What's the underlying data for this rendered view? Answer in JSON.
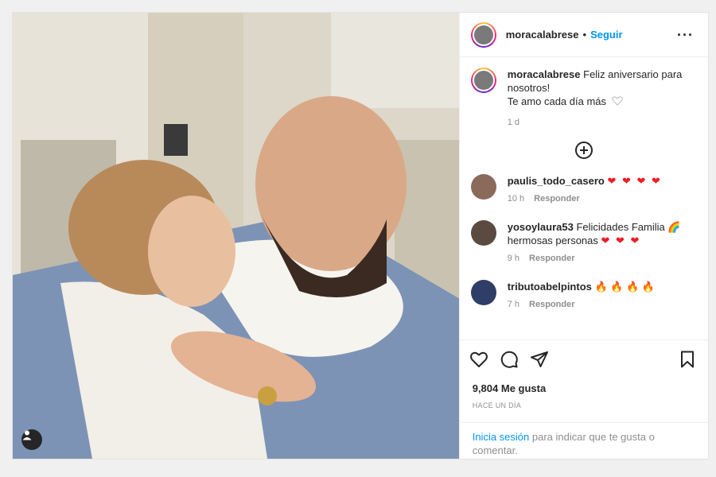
{
  "post": {
    "username": "moracalabrese",
    "follow_label": "Seguir",
    "separator": "•",
    "more_label": "···",
    "caption_line1": "Feliz aniversario para nosotros!",
    "caption_line2": "Te amo cada día más",
    "caption_time": "1 d",
    "likes": "9,804 Me gusta",
    "posted_ago": "HACE UN DÍA"
  },
  "comments": [
    {
      "user": "paulis_todo_casero",
      "text": "",
      "emoji": "❤ ❤ ❤ ❤",
      "time": "10 h",
      "reply": "Responder"
    },
    {
      "user": "yosoylaura53",
      "text": "Felicidades Familia 🌈 hermosas personas",
      "emoji": "❤ ❤ ❤",
      "time": "9 h",
      "reply": "Responder"
    },
    {
      "user": "tributoabelpintos",
      "text": "",
      "emoji": "🔥 🔥 🔥 🔥",
      "time": "7 h",
      "reply": "Responder"
    }
  ],
  "login": {
    "link": "Inicia sesión",
    "rest": " para indicar que te gusta o comentar."
  },
  "icons": [
    "heart-icon",
    "comment-icon",
    "share-icon",
    "bookmark-icon",
    "add-comment-icon",
    "user-tag-icon",
    "more-icon"
  ],
  "colors": {
    "accent": "#0095f6",
    "heart": "#ed1c24",
    "text": "#262626",
    "muted": "#8e8e8e"
  }
}
